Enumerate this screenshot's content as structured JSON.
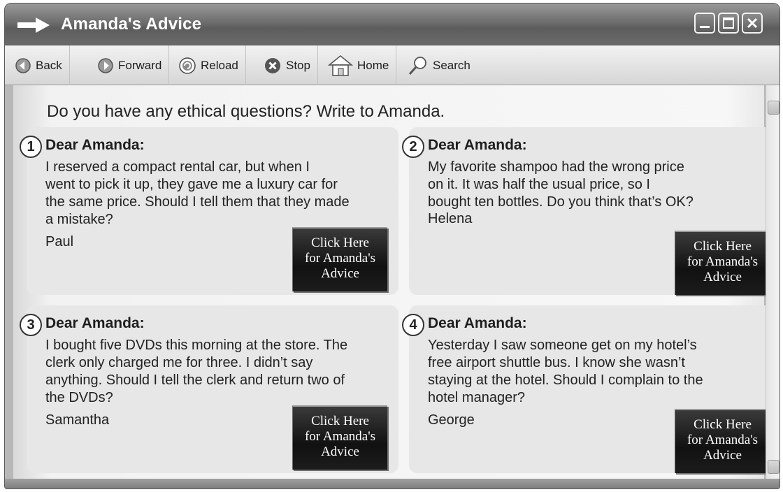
{
  "window": {
    "title": "Amanda's Advice",
    "icons": [
      "arrow-right-icon",
      "minimize-icon",
      "maximize-icon",
      "close-icon"
    ]
  },
  "toolbar": {
    "back": "Back",
    "forward": "Forward",
    "reload": "Reload",
    "stop": "Stop",
    "home": "Home",
    "search": "Search"
  },
  "main": {
    "heading": "Do you have any ethical questions? Write to Amanda.",
    "advice_button": "Click Here\nfor Amanda's\nAdvice",
    "letters": [
      {
        "number": "1",
        "greeting": "Dear Amanda:",
        "body": "I reserved a compact rental car, but when I\nwent to pick it up, they gave me a luxury car for\nthe same price. Should I tell them that they made\na mistake?",
        "signature": "Paul"
      },
      {
        "number": "2",
        "greeting": "Dear Amanda:",
        "body": "My favorite shampoo had the wrong price\non it. It was half the usual price, so I\nbought ten bottles. Do you think that’s OK?",
        "signature": "Helena"
      },
      {
        "number": "3",
        "greeting": "Dear Amanda:",
        "body": "I bought five DVDs this morning at the store. The\nclerk only charged me for three. I didn’t say\nanything. Should I tell the clerk and return two of\nthe DVDs?",
        "signature": "Samantha"
      },
      {
        "number": "4",
        "greeting": "Dear Amanda:",
        "body": "Yesterday I saw someone get on my hotel’s\nfree airport shuttle bus. I know she wasn’t\nstaying at the hotel. Should I complain to the\nhotel manager?",
        "signature": "George"
      }
    ]
  }
}
